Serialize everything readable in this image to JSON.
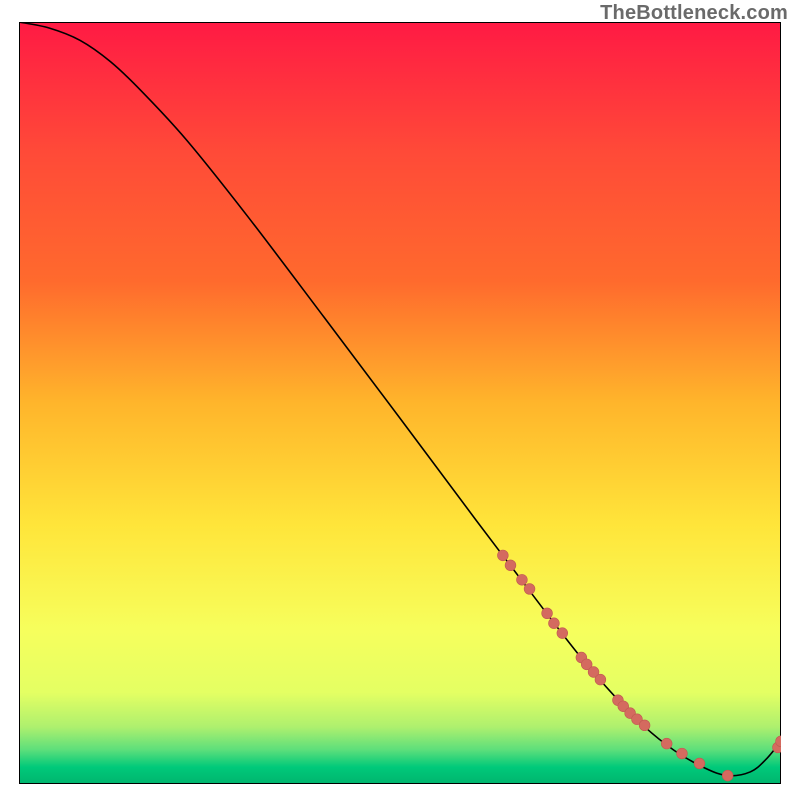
{
  "watermark": "TheBottleneck.com",
  "colors": {
    "gradient_top": "#ff1a44",
    "gradient_mid1": "#ff6a2d",
    "gradient_mid2": "#ffb52b",
    "gradient_mid3": "#ffe53a",
    "gradient_bottom_yellow": "#f6ff5d",
    "gradient_green1": "#aef06e",
    "gradient_green2": "#00c97a",
    "axis": "#000000",
    "curve": "#000000",
    "marker_fill": "#d46a5f",
    "marker_stroke": "#c05a50"
  },
  "chart_data": {
    "type": "line",
    "title": "",
    "xlabel": "",
    "ylabel": "",
    "xlim": [
      0,
      100
    ],
    "ylim": [
      0,
      100
    ],
    "curve": {
      "x": [
        0,
        4,
        8,
        12,
        16,
        22,
        30,
        40,
        50,
        60,
        65,
        70,
        74,
        78,
        82,
        86,
        90,
        93,
        96,
        98,
        100
      ],
      "y": [
        100,
        99.2,
        97.6,
        94.8,
        91,
        84.5,
        74.5,
        61.3,
        48,
        34.6,
        28,
        21.4,
        16.3,
        11.7,
        7.6,
        4.4,
        2.1,
        1.1,
        1.6,
        3.2,
        5.6
      ]
    },
    "markers": {
      "x": [
        63.5,
        64.5,
        66.0,
        67.0,
        69.3,
        70.2,
        71.3,
        73.8,
        74.5,
        75.4,
        76.3,
        78.6,
        79.3,
        80.2,
        81.1,
        82.1,
        85.0,
        87.0,
        89.3,
        93.0,
        99.6,
        100.0
      ],
      "y": [
        30.0,
        28.7,
        26.8,
        25.6,
        22.4,
        21.1,
        19.8,
        16.6,
        15.7,
        14.7,
        13.7,
        11.0,
        10.2,
        9.3,
        8.5,
        7.7,
        5.3,
        4.0,
        2.7,
        1.1,
        4.8,
        5.6
      ]
    }
  }
}
